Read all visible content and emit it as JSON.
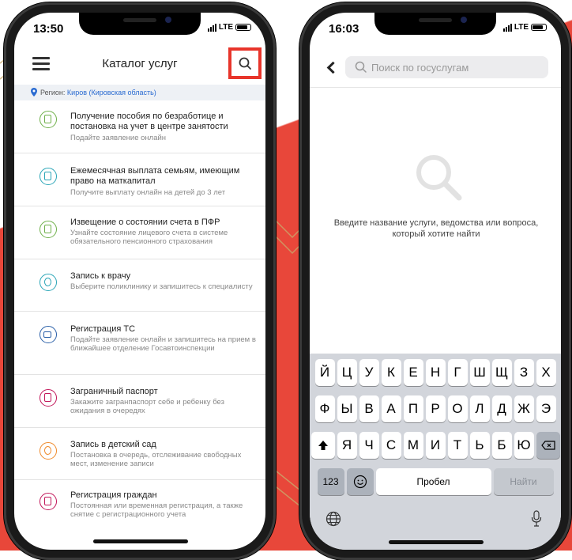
{
  "left_screen": {
    "status_time": "13:50",
    "network": "LTE",
    "header_title": "Каталог услуг",
    "region_label": "Регион:",
    "region_value": "Киров (Кировская область)",
    "services": [
      {
        "title": "Получение пособия по безработице и постановка на учет в центре занятости",
        "desc": "Подайте заявление онлайн",
        "icon": "document-icon",
        "color": "#6fb04a"
      },
      {
        "title": "Ежемесячная выплата семьям, имеющим право на маткапитал",
        "desc": "Получите выплату онлайн на детей до 3 лет",
        "icon": "calculator-icon",
        "color": "#2aa5b7"
      },
      {
        "title": "Извещение о состоянии счета в ПФР",
        "desc": "Узнайте состояние лицевого счета в системе обязательного пенсионного страхования",
        "icon": "edit-document-icon",
        "color": "#6fb04a"
      },
      {
        "title": "Запись к врачу",
        "desc": "Выберите поликлинику и запишитесь к специалисту",
        "icon": "stethoscope-icon",
        "color": "#2aa5b7"
      },
      {
        "title": "Регистрация ТС",
        "desc": "Подайте заявление онлайн и запишитесь на прием в ближайшее отделение Госавтоинспекции",
        "icon": "car-icon",
        "color": "#2a5fa8"
      },
      {
        "title": "Заграничный паспорт",
        "desc": "Закажите загранпаспорт себе и ребенку без ожидания в очередях",
        "icon": "passport-icon",
        "color": "#c2185b"
      },
      {
        "title": "Запись в детский сад",
        "desc": "Постановка в очередь, отслеживание свободных мест, изменение записи",
        "icon": "kindergarten-icon",
        "color": "#ef8a2b"
      },
      {
        "title": "Регистрация граждан",
        "desc": "Постоянная или временная регистрация, а также снятие с регистрационного учета",
        "icon": "house-icon",
        "color": "#c2185b"
      }
    ]
  },
  "right_screen": {
    "status_time": "16:03",
    "network": "LTE",
    "search_placeholder": "Поиск по госуслугам",
    "empty_message": "Введите название услуги, ведомства или вопроса, который хотите найти",
    "keyboard": {
      "row1": [
        "Й",
        "Ц",
        "У",
        "К",
        "Е",
        "Н",
        "Г",
        "Ш",
        "Щ",
        "З",
        "Х"
      ],
      "row2": [
        "Ф",
        "Ы",
        "В",
        "А",
        "П",
        "Р",
        "О",
        "Л",
        "Д",
        "Ж",
        "Э"
      ],
      "row3": [
        "Я",
        "Ч",
        "С",
        "М",
        "И",
        "Т",
        "Ь",
        "Б",
        "Ю"
      ],
      "numbers_key": "123",
      "space_key": "Пробел",
      "go_key": "Найти"
    }
  },
  "colors": {
    "accent_red": "#e8473a",
    "highlight_border": "#e8352b",
    "link_blue": "#2a6bd1"
  }
}
